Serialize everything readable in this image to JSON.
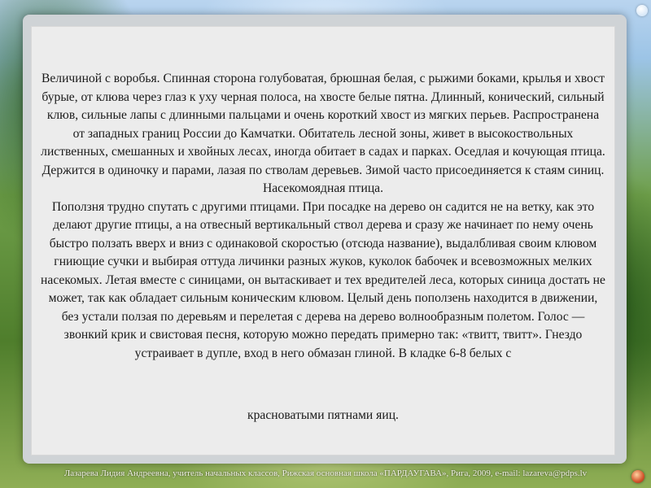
{
  "document": {
    "paragraphs": [
      "Величиной с воробья. Спинная сторона голубоватая, брюшная белая, с рыжими боками, крылья и хвост бурые, от клюва через глаз к уху черная полоса, на хвосте белые пятна. Длинный, конический, сильный клюв, сильные лапы с длинными пальцами и очень короткий хвост из мягких перьев. Распространена от западных границ России до Камчатки. Обитатель лесной зоны, живет в высокоствольных лиственных, смешанных и хвойных лесах, иногда обитает в садах и парках. Оседлая и кочующая птица. Держится в одиночку и парами, лазая по стволам деревьев. Зимой часто присоединяется к стаям синиц. Насекомоядная птица.",
      "Поползня трудно спутать с другими птицами. При посадке на дерево он садится не на ветку, как это делают другие птицы, а на отвесный вертикальный ствол дерева и сразу же начинает по нему очень быстро ползать вверх и вниз с одинаковой скоростью (отсюда название), выдалбливая своим клювом гниющие сучки и выбирая оттуда личинки разных жуков, куколок бабочек и всевозможных мелких насекомых. Летая вместе с синицами, он вытаскивает и тех вредителей леса, которых синица достать не может, так как обладает сильным коническим клювом. Целый день поползень находится в движении, без устали ползая по деревьям и перелетая с дерева на дерево волнообразным полетом. Голос — звонкий крик и свистовая песня, которую можно передать примерно так: «твитт, твитт». Гнездо устраивает в дупле, вход в него обмазан глиной. В кладке 6-8 белых с"
    ],
    "closing_line": "красноватыми пятнами яиц."
  },
  "footer": {
    "credit": "Лазарева Лидия Андреевна,  учитель начальных классов,  Рижская основная школа «ПАРДАУГАВА»,  Рига,  2009,  e-mail: lazareva@pdps.lv"
  }
}
